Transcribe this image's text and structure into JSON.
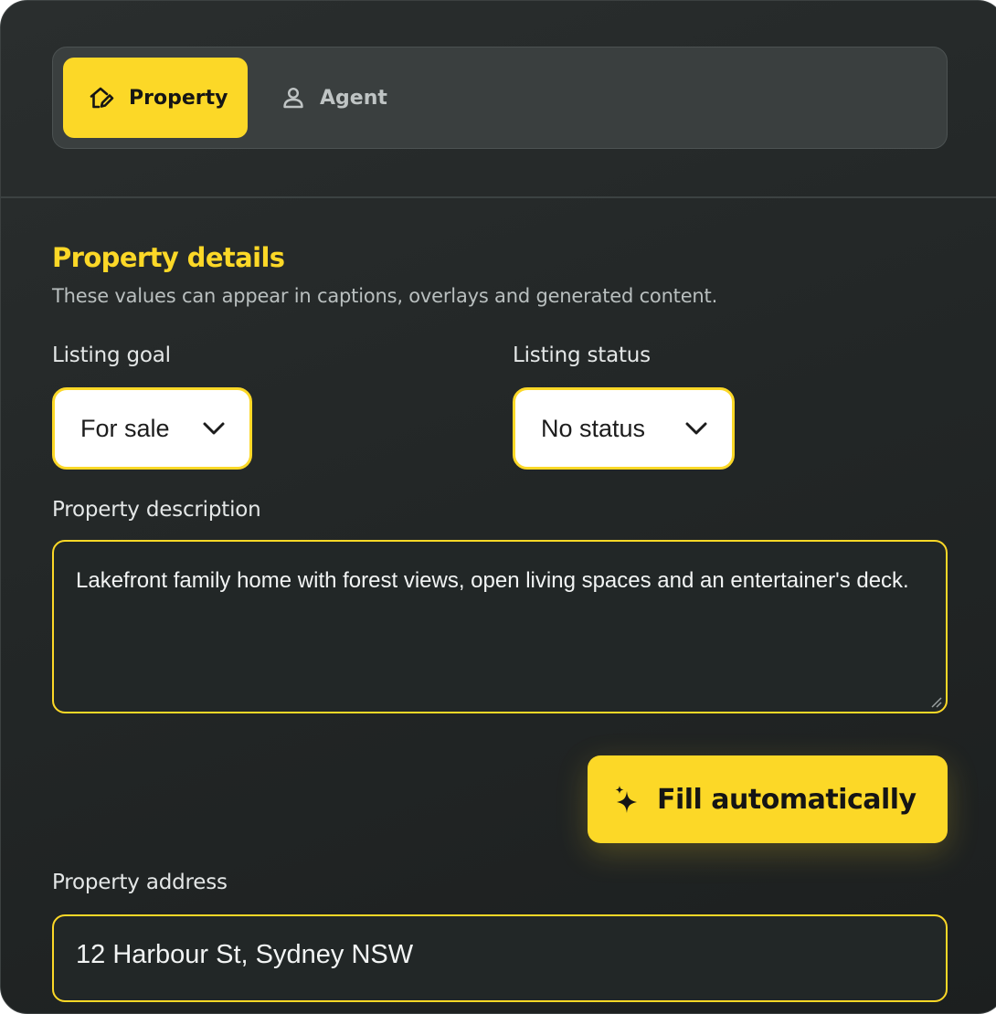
{
  "tabs": [
    {
      "label": "Property",
      "icon": "home-edit-icon",
      "active": true
    },
    {
      "label": "Agent",
      "icon": "user-icon",
      "active": false
    }
  ],
  "section": {
    "title": "Property details",
    "subtitle": "These values can appear in captions, overlays and generated content."
  },
  "fields": {
    "listing_goal": {
      "label": "Listing goal",
      "value": "For sale"
    },
    "listing_status": {
      "label": "Listing status",
      "value": "No status"
    },
    "description": {
      "label": "Property description",
      "value": "Lakefront family home with forest views, open living spaces and an entertainer's deck."
    },
    "address": {
      "label": "Property address",
      "value": "12 Harbour St, Sydney NSW"
    }
  },
  "actions": {
    "fill_label": "Fill automatically",
    "fill_icon": "sparkles-icon"
  },
  "colors": {
    "accent": "#fcd827",
    "background": "#232727",
    "surface": "#3a3f3f"
  }
}
